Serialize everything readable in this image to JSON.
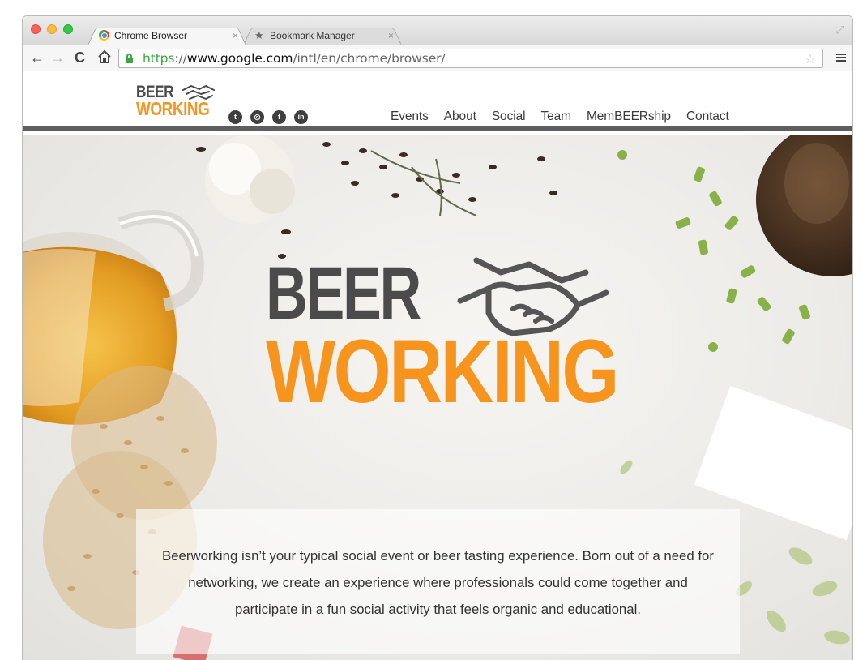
{
  "browser": {
    "tabs": [
      {
        "title": "Chrome Browser",
        "icon": "chrome-icon",
        "active": true
      },
      {
        "title": "Bookmark Manager",
        "icon": "star-icon",
        "active": false
      }
    ],
    "close_glyph": "×",
    "url": {
      "scheme": "https",
      "separator": "://",
      "host": "www.google.com",
      "path": "/intl/en/chrome/browser/"
    }
  },
  "site": {
    "logo": {
      "line1": "BEER",
      "line2": "WORKING"
    },
    "social": [
      {
        "name": "twitter-icon",
        "glyph": "t"
      },
      {
        "name": "instagram-icon",
        "glyph": "◎"
      },
      {
        "name": "facebook-icon",
        "glyph": "f"
      },
      {
        "name": "linkedin-icon",
        "glyph": "in"
      }
    ],
    "nav": [
      "Events",
      "About",
      "Social",
      "Team",
      "MemBEERship",
      "Contact"
    ],
    "hero_logo": {
      "line1": "BEER",
      "line2": "WORKING"
    },
    "intro_text": "Beerworking isn’t your typical social event or beer tasting experience. Born out of a need for networking, we create an experience where professionals could come together and participate in a fun social activity that feels organic and educational."
  },
  "colors": {
    "brand_orange": "#f7941d",
    "brand_gray": "#4b4b4b",
    "secure_green": "#3aa83f"
  }
}
